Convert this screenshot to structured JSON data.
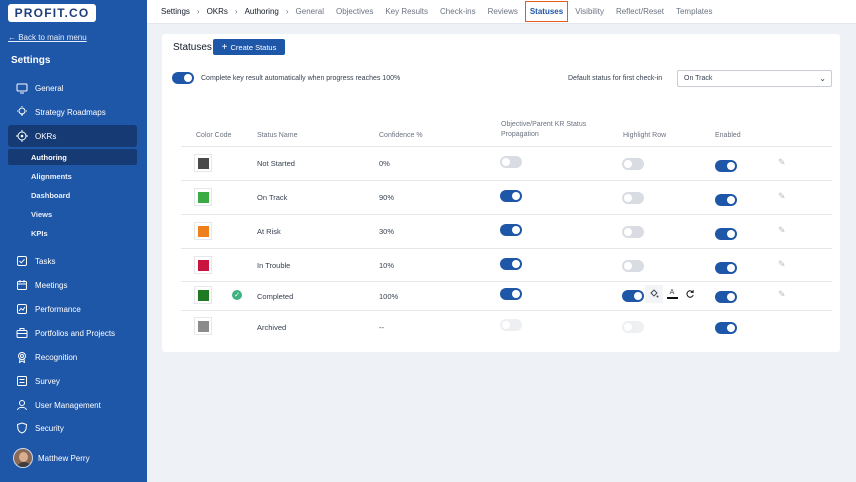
{
  "app": {
    "logo": "PROFIT.CO"
  },
  "sidebar": {
    "back_link": "← Back to main menu",
    "title": "Settings",
    "items": [
      {
        "label": "General",
        "icon": "monitor-icon"
      },
      {
        "label": "Strategy Roadmaps",
        "icon": "bulb-icon"
      },
      {
        "label": "OKRs",
        "icon": "target-icon"
      },
      {
        "label": "Tasks",
        "icon": "checkbox-icon"
      },
      {
        "label": "Meetings",
        "icon": "calendar-icon"
      },
      {
        "label": "Performance",
        "icon": "chart-icon"
      },
      {
        "label": "Portfolios and Projects",
        "icon": "briefcase-icon"
      },
      {
        "label": "Recognition",
        "icon": "award-icon"
      },
      {
        "label": "Survey",
        "icon": "survey-icon"
      },
      {
        "label": "User Management",
        "icon": "user-icon"
      },
      {
        "label": "Security",
        "icon": "shield-icon"
      }
    ],
    "okr_sub": [
      "Authoring",
      "Alignments",
      "Dashboard",
      "Views",
      "KPIs"
    ],
    "user_name": "Matthew Perry"
  },
  "topbar": {
    "breadcrumb": [
      "Settings",
      "OKRs",
      "Authoring"
    ],
    "tabs": [
      "General",
      "Objectives",
      "Key Results",
      "Check-ins",
      "Reviews",
      "Statuses",
      "Visibility",
      "Reflect/Reset",
      "Templates"
    ],
    "active_tab": "Statuses"
  },
  "card": {
    "title": "Statuses",
    "create_button": "Create Status",
    "auto_complete_label": "Complete key result automatically when progress reaches 100%",
    "auto_complete_enabled": true,
    "default_status_label": "Default status for first check-in",
    "default_status_value": "On Track"
  },
  "table": {
    "headers": {
      "color_code": "Color Code",
      "status_name": "Status Name",
      "confidence": "Confidence %",
      "propagation_line1": "Objective/Parent KR Status",
      "propagation_line2": "Propagation",
      "highlight": "Highlight Row",
      "enabled": "Enabled"
    },
    "rows": [
      {
        "color": "#4a4a4a",
        "name": "Not Started",
        "confidence": "0%",
        "propagation": false,
        "highlight": false,
        "enabled": true
      },
      {
        "color": "#3bab46",
        "name": "On Track",
        "confidence": "90%",
        "propagation": true,
        "highlight": false,
        "enabled": true
      },
      {
        "color": "#ee7f1a",
        "name": "At Risk",
        "confidence": "30%",
        "propagation": true,
        "highlight": false,
        "enabled": true
      },
      {
        "color": "#c8143f",
        "name": "In Trouble",
        "confidence": "10%",
        "propagation": true,
        "highlight": false,
        "enabled": true
      },
      {
        "color": "#1f7a23",
        "name": "Completed",
        "confidence": "100%",
        "propagation": true,
        "highlight": true,
        "enabled": true
      },
      {
        "color": "#8c8c8c",
        "name": "Archived",
        "confidence": "--",
        "propagation": false,
        "highlight": false,
        "enabled": true
      }
    ],
    "text_color_tool_label": "A"
  }
}
